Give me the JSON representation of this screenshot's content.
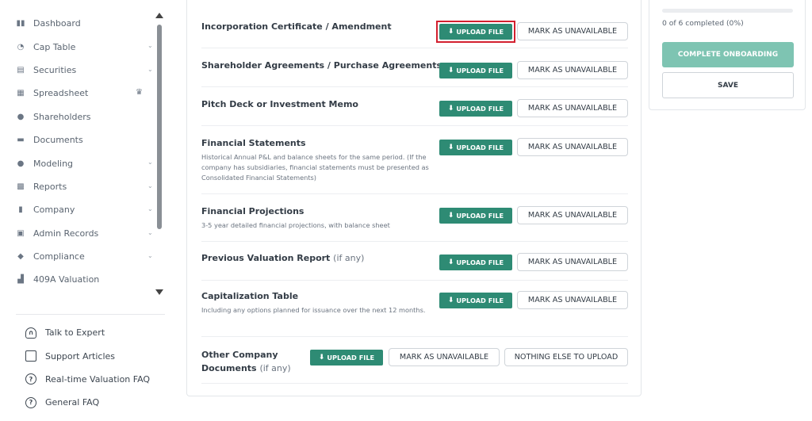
{
  "sidebar": {
    "items": [
      {
        "label": "Dashboard",
        "icon": "dashboard-icon",
        "glyph": "▮▮",
        "chevron": false
      },
      {
        "label": "Cap Table",
        "icon": "pie-chart-icon",
        "glyph": "◔",
        "chevron": true
      },
      {
        "label": "Securities",
        "icon": "clipboard-icon",
        "glyph": "▤",
        "chevron": true
      },
      {
        "label": "Spreadsheet",
        "icon": "spreadsheet-icon",
        "glyph": "▦",
        "chevron": false,
        "crown": true
      },
      {
        "label": "Shareholders",
        "icon": "person-icon",
        "glyph": "●",
        "chevron": false
      },
      {
        "label": "Documents",
        "icon": "folder-icon",
        "glyph": "▬",
        "chevron": false
      },
      {
        "label": "Modeling",
        "icon": "lightbulb-icon",
        "glyph": "●",
        "chevron": true
      },
      {
        "label": "Reports",
        "icon": "report-icon",
        "glyph": "▩",
        "chevron": true
      },
      {
        "label": "Company",
        "icon": "building-icon",
        "glyph": "▮",
        "chevron": true
      },
      {
        "label": "Admin Records",
        "icon": "admin-records-icon",
        "glyph": "▣",
        "chevron": true
      },
      {
        "label": "Compliance",
        "icon": "shield-check-icon",
        "glyph": "◆",
        "chevron": true
      },
      {
        "label": "409A Valuation",
        "icon": "bar-chart-icon",
        "glyph": "▟",
        "chevron": false
      }
    ],
    "help": [
      {
        "label": "Talk to Expert",
        "icon": "headset-icon",
        "glyph": "∩",
        "style": "headset"
      },
      {
        "label": "Support Articles",
        "icon": "book-icon",
        "glyph": "",
        "style": "book"
      },
      {
        "label": "Real-time Valuation FAQ",
        "icon": "question-circle-icon",
        "glyph": "?",
        "style": "circle"
      },
      {
        "label": "General FAQ",
        "icon": "question-circle-icon",
        "glyph": "?",
        "style": "circle"
      }
    ]
  },
  "buttons": {
    "upload": "UPLOAD FILE",
    "unavailable": "MARK AS UNAVAILABLE",
    "nothing_else": "NOTHING ELSE TO UPLOAD"
  },
  "documents": [
    {
      "title": "Incorporation Certificate / Amendment",
      "suffix": "",
      "desc": "",
      "highlighted": true
    },
    {
      "title": "Shareholder Agreements / Purchase Agreements",
      "suffix": "",
      "desc": ""
    },
    {
      "title": "Pitch Deck or Investment Memo",
      "suffix": "",
      "desc": ""
    },
    {
      "title": "Financial Statements",
      "suffix": "",
      "desc": "Historical Annual P&L and balance sheets for the same period. (If the company has subsidiaries, financial statements must be presented as Consolidated Financial Statements)"
    },
    {
      "title": "Financial Projections",
      "suffix": "",
      "desc": "3-5 year detailed financial projections, with balance sheet"
    },
    {
      "title": "Previous Valuation Report",
      "suffix": "(if any)",
      "desc": ""
    },
    {
      "title": "Capitalization Table",
      "suffix": "",
      "desc": "Including any options planned for issuance over the next 12 months."
    }
  ],
  "other_docs": {
    "title_line1": "Other Company",
    "title_line2": "Documents",
    "suffix": "(if any)"
  },
  "progress": {
    "text": "0 of 6 completed (0%)",
    "fraction": 0
  },
  "right_panel": {
    "complete_label": "COMPLETE ONBOARDING",
    "save_label": "SAVE"
  },
  "colors": {
    "accent": "#2e8b74",
    "accent_light": "#7ec4b2",
    "highlight": "#d3202f"
  }
}
